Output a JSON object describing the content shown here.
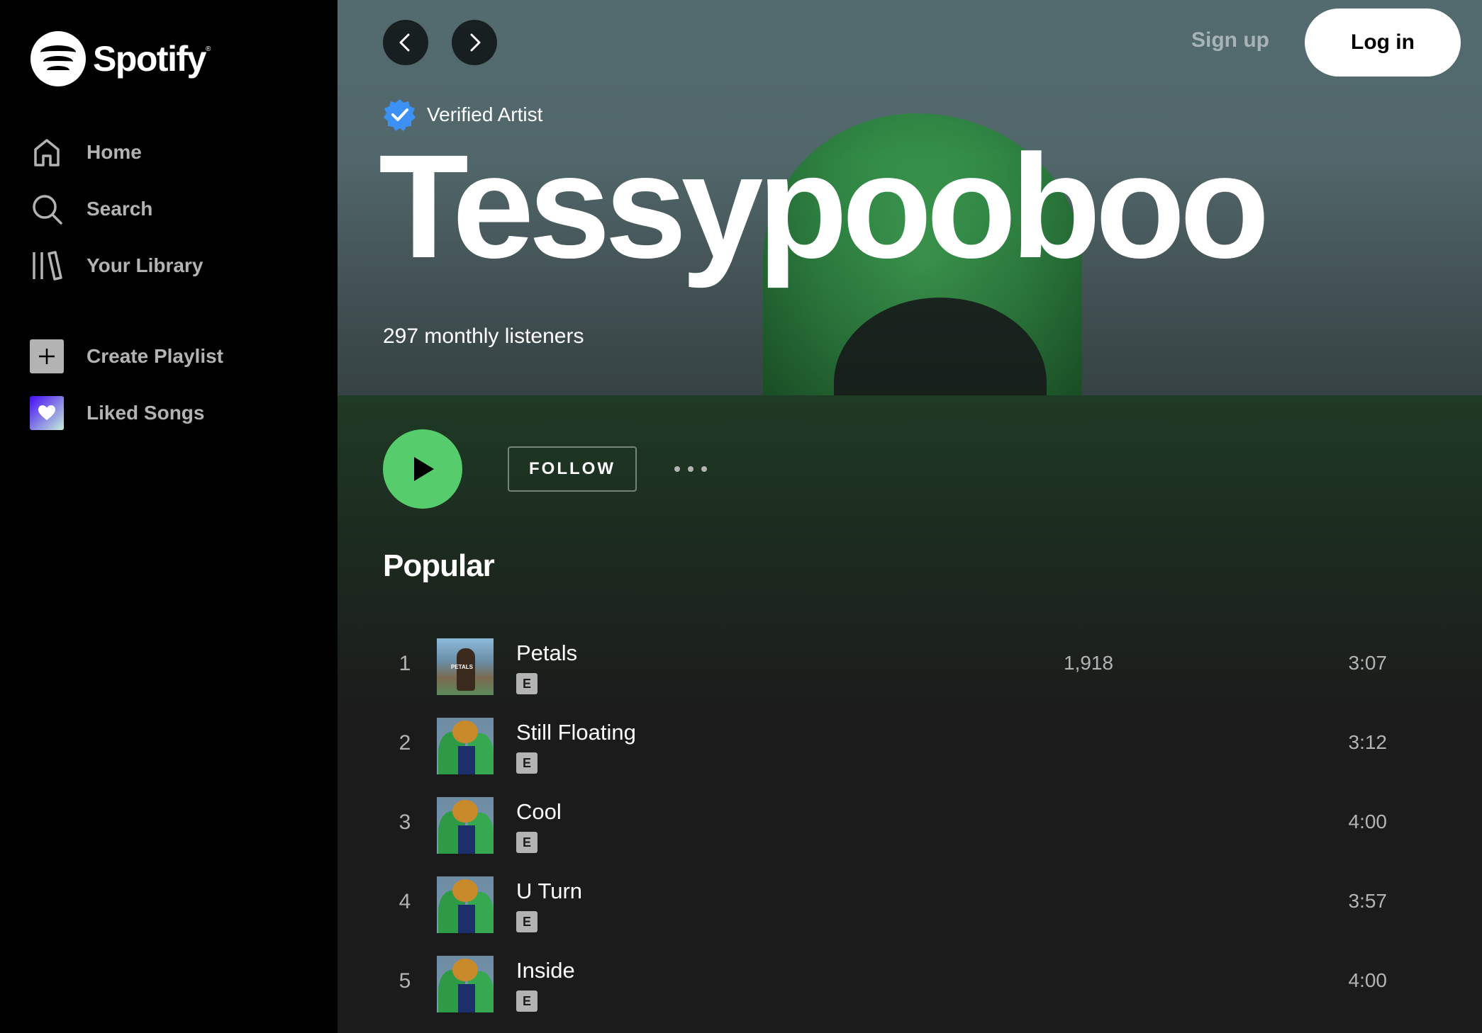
{
  "brand": {
    "name": "Spotify",
    "accent_color": "#1ed760",
    "logo_icon": "spotify-logo-icon"
  },
  "sidebar": {
    "nav": [
      {
        "label": "Home",
        "icon": "home-icon"
      },
      {
        "label": "Search",
        "icon": "search-icon"
      },
      {
        "label": "Your Library",
        "icon": "library-icon"
      }
    ],
    "actions": [
      {
        "label": "Create Playlist",
        "icon": "plus-icon"
      },
      {
        "label": "Liked Songs",
        "icon": "heart-icon"
      }
    ]
  },
  "header": {
    "sign_up_label": "Sign up",
    "log_in_label": "Log in"
  },
  "artist": {
    "verified_label": "Verified Artist",
    "name": "Tessypooboo",
    "monthly_listeners": "297 monthly listeners"
  },
  "action_bar": {
    "follow_label": "FOLLOW"
  },
  "popular": {
    "title": "Popular",
    "tracks": [
      {
        "number": "1",
        "title": "Petals",
        "explicit": "E",
        "plays": "1,918",
        "duration": "3:07",
        "cover_text": "PETALS"
      },
      {
        "number": "2",
        "title": "Still Floating",
        "explicit": "E",
        "plays": "",
        "duration": "3:12"
      },
      {
        "number": "3",
        "title": "Cool",
        "explicit": "E",
        "plays": "",
        "duration": "4:00"
      },
      {
        "number": "4",
        "title": "U Turn",
        "explicit": "E",
        "plays": "",
        "duration": "3:57"
      },
      {
        "number": "5",
        "title": "Inside",
        "explicit": "E",
        "plays": "",
        "duration": "4:00"
      }
    ]
  }
}
